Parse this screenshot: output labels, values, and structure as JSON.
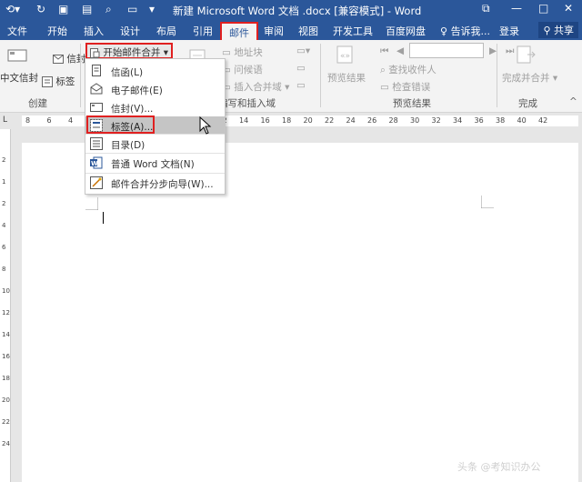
{
  "window": {
    "title": "新建 Microsoft Word 文档 .docx [兼容模式] - Word",
    "buttons": {
      "minimize": "—",
      "restore": "□",
      "close": "✕",
      "ribbon_opts": "⧉"
    }
  },
  "tabs": [
    {
      "label": "文件"
    },
    {
      "label": "开始"
    },
    {
      "label": "插入"
    },
    {
      "label": "设计"
    },
    {
      "label": "布局"
    },
    {
      "label": "引用"
    },
    {
      "label": "邮件"
    },
    {
      "label": "审阅"
    },
    {
      "label": "视图"
    },
    {
      "label": "开发工具"
    },
    {
      "label": "百度网盘"
    }
  ],
  "tell_me": "告诉我...",
  "login": "登录",
  "share": "共享",
  "ribbon": {
    "create": {
      "envelope": "信封",
      "zh_envelope": "中文信封",
      "label": "标签",
      "group": "创建"
    },
    "start_mail_merge": "开始邮件合并",
    "write_insert": {
      "address_block": "地址块",
      "greeting": "问候语",
      "insert_field": "插入合并域",
      "group": "编写和插入域"
    },
    "preview": {
      "preview_results": "预览结果",
      "find_recipient": "查找收件人",
      "check_errors": "检查错误",
      "group": "预览结果"
    },
    "finish": {
      "finish_merge": "完成并合并",
      "group": "完成"
    }
  },
  "menu": [
    {
      "label": "信函(L)",
      "icon": "letter-icon"
    },
    {
      "label": "电子邮件(E)",
      "icon": "email-icon"
    },
    {
      "label": "信封(V)...",
      "icon": "envelope-icon"
    },
    {
      "label": "标签(A)...",
      "icon": "label-icon",
      "hover": true
    },
    {
      "label": "目录(D)",
      "icon": "directory-icon"
    },
    {
      "label": "普通 Word 文档(N)",
      "icon": "word-doc-icon"
    },
    {
      "label": "邮件合并分步向导(W)...",
      "icon": "wizard-icon"
    }
  ],
  "ruler": [
    "8",
    "6",
    "4",
    "2",
    "2",
    "4",
    "6",
    "8",
    "10",
    "12",
    "14",
    "16",
    "18",
    "20",
    "22",
    "24",
    "26",
    "28",
    "30",
    "32",
    "34",
    "36",
    "38",
    "40",
    "42"
  ],
  "vruler": [
    "2",
    "1",
    "2",
    "4",
    "6",
    "8",
    "10",
    "12",
    "14",
    "16",
    "18",
    "20",
    "22",
    "24"
  ],
  "watermark": "头条 @考知识办公",
  "colors": {
    "accent": "#2b579a",
    "highlight": "#e02020"
  }
}
